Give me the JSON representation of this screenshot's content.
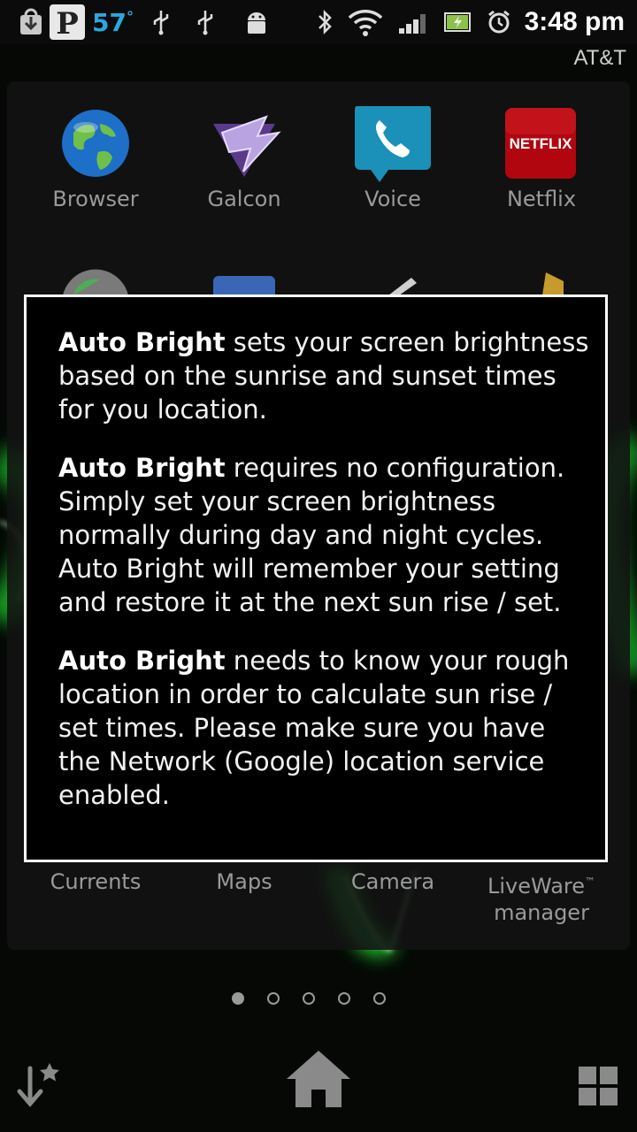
{
  "status_bar": {
    "temperature": "57",
    "temperature_unit": "°",
    "time": "3:48 pm",
    "carrier": "AT&T",
    "icons": [
      "download-icon",
      "pandora-icon",
      "usb-icon",
      "usb-icon",
      "android-debug-icon",
      "bluetooth-icon",
      "wifi-icon",
      "signal-icon",
      "battery-charging-icon",
      "alarm-icon"
    ]
  },
  "apps_row1": [
    {
      "label": "Browser",
      "icon": "globe-icon"
    },
    {
      "label": "Galcon",
      "icon": "galcon-icon"
    },
    {
      "label": "Voice",
      "icon": "phone-icon"
    },
    {
      "label": "Netflix",
      "icon": "netflix-icon",
      "icon_text": "NETFLIX"
    }
  ],
  "apps_row3": [
    {
      "label": "Currents"
    },
    {
      "label": "Maps"
    },
    {
      "label": "Camera"
    },
    {
      "label": "LiveWare",
      "label_tm": "™",
      "label_line2": "manager"
    }
  ],
  "dialog": {
    "bold_name": "Auto Bright",
    "p1": " sets your screen brightness based on the sunrise and sunset times for you location.",
    "p2": " requires no configuration. Simply set your screen brightness normally during day and night cycles. Auto Bright will remember your setting and restore it at the next sun rise / set.",
    "p3": " needs to know your rough location in order to calculate sun rise / set times. Please make sure you have the Network (Google) location service enabled."
  },
  "page_indicator": {
    "count": 5,
    "active_index": 0
  },
  "dock": [
    "favorites-icon",
    "home-icon",
    "app-grid-icon"
  ],
  "colors": {
    "accent": "#29a8e0",
    "wallpaper_glow": "#2aff3a"
  }
}
